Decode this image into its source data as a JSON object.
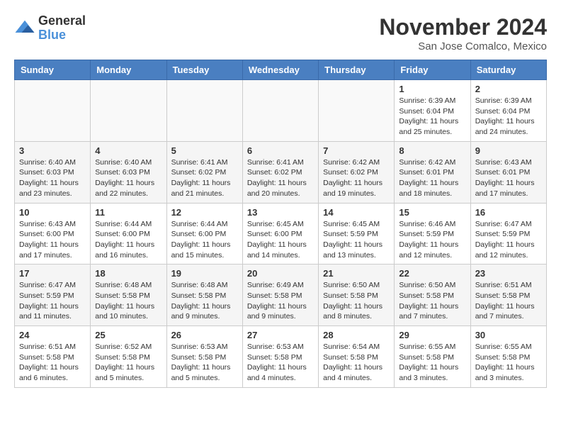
{
  "logo": {
    "general": "General",
    "blue": "Blue"
  },
  "title": "November 2024",
  "location": "San Jose Comalco, Mexico",
  "days_of_week": [
    "Sunday",
    "Monday",
    "Tuesday",
    "Wednesday",
    "Thursday",
    "Friday",
    "Saturday"
  ],
  "weeks": [
    [
      {
        "day": "",
        "info": ""
      },
      {
        "day": "",
        "info": ""
      },
      {
        "day": "",
        "info": ""
      },
      {
        "day": "",
        "info": ""
      },
      {
        "day": "",
        "info": ""
      },
      {
        "day": "1",
        "info": "Sunrise: 6:39 AM\nSunset: 6:04 PM\nDaylight: 11 hours\nand 25 minutes."
      },
      {
        "day": "2",
        "info": "Sunrise: 6:39 AM\nSunset: 6:04 PM\nDaylight: 11 hours\nand 24 minutes."
      }
    ],
    [
      {
        "day": "3",
        "info": "Sunrise: 6:40 AM\nSunset: 6:03 PM\nDaylight: 11 hours\nand 23 minutes."
      },
      {
        "day": "4",
        "info": "Sunrise: 6:40 AM\nSunset: 6:03 PM\nDaylight: 11 hours\nand 22 minutes."
      },
      {
        "day": "5",
        "info": "Sunrise: 6:41 AM\nSunset: 6:02 PM\nDaylight: 11 hours\nand 21 minutes."
      },
      {
        "day": "6",
        "info": "Sunrise: 6:41 AM\nSunset: 6:02 PM\nDaylight: 11 hours\nand 20 minutes."
      },
      {
        "day": "7",
        "info": "Sunrise: 6:42 AM\nSunset: 6:02 PM\nDaylight: 11 hours\nand 19 minutes."
      },
      {
        "day": "8",
        "info": "Sunrise: 6:42 AM\nSunset: 6:01 PM\nDaylight: 11 hours\nand 18 minutes."
      },
      {
        "day": "9",
        "info": "Sunrise: 6:43 AM\nSunset: 6:01 PM\nDaylight: 11 hours\nand 17 minutes."
      }
    ],
    [
      {
        "day": "10",
        "info": "Sunrise: 6:43 AM\nSunset: 6:00 PM\nDaylight: 11 hours\nand 17 minutes."
      },
      {
        "day": "11",
        "info": "Sunrise: 6:44 AM\nSunset: 6:00 PM\nDaylight: 11 hours\nand 16 minutes."
      },
      {
        "day": "12",
        "info": "Sunrise: 6:44 AM\nSunset: 6:00 PM\nDaylight: 11 hours\nand 15 minutes."
      },
      {
        "day": "13",
        "info": "Sunrise: 6:45 AM\nSunset: 6:00 PM\nDaylight: 11 hours\nand 14 minutes."
      },
      {
        "day": "14",
        "info": "Sunrise: 6:45 AM\nSunset: 5:59 PM\nDaylight: 11 hours\nand 13 minutes."
      },
      {
        "day": "15",
        "info": "Sunrise: 6:46 AM\nSunset: 5:59 PM\nDaylight: 11 hours\nand 12 minutes."
      },
      {
        "day": "16",
        "info": "Sunrise: 6:47 AM\nSunset: 5:59 PM\nDaylight: 11 hours\nand 12 minutes."
      }
    ],
    [
      {
        "day": "17",
        "info": "Sunrise: 6:47 AM\nSunset: 5:59 PM\nDaylight: 11 hours\nand 11 minutes."
      },
      {
        "day": "18",
        "info": "Sunrise: 6:48 AM\nSunset: 5:58 PM\nDaylight: 11 hours\nand 10 minutes."
      },
      {
        "day": "19",
        "info": "Sunrise: 6:48 AM\nSunset: 5:58 PM\nDaylight: 11 hours\nand 9 minutes."
      },
      {
        "day": "20",
        "info": "Sunrise: 6:49 AM\nSunset: 5:58 PM\nDaylight: 11 hours\nand 9 minutes."
      },
      {
        "day": "21",
        "info": "Sunrise: 6:50 AM\nSunset: 5:58 PM\nDaylight: 11 hours\nand 8 minutes."
      },
      {
        "day": "22",
        "info": "Sunrise: 6:50 AM\nSunset: 5:58 PM\nDaylight: 11 hours\nand 7 minutes."
      },
      {
        "day": "23",
        "info": "Sunrise: 6:51 AM\nSunset: 5:58 PM\nDaylight: 11 hours\nand 7 minutes."
      }
    ],
    [
      {
        "day": "24",
        "info": "Sunrise: 6:51 AM\nSunset: 5:58 PM\nDaylight: 11 hours\nand 6 minutes."
      },
      {
        "day": "25",
        "info": "Sunrise: 6:52 AM\nSunset: 5:58 PM\nDaylight: 11 hours\nand 5 minutes."
      },
      {
        "day": "26",
        "info": "Sunrise: 6:53 AM\nSunset: 5:58 PM\nDaylight: 11 hours\nand 5 minutes."
      },
      {
        "day": "27",
        "info": "Sunrise: 6:53 AM\nSunset: 5:58 PM\nDaylight: 11 hours\nand 4 minutes."
      },
      {
        "day": "28",
        "info": "Sunrise: 6:54 AM\nSunset: 5:58 PM\nDaylight: 11 hours\nand 4 minutes."
      },
      {
        "day": "29",
        "info": "Sunrise: 6:55 AM\nSunset: 5:58 PM\nDaylight: 11 hours\nand 3 minutes."
      },
      {
        "day": "30",
        "info": "Sunrise: 6:55 AM\nSunset: 5:58 PM\nDaylight: 11 hours\nand 3 minutes."
      }
    ]
  ]
}
